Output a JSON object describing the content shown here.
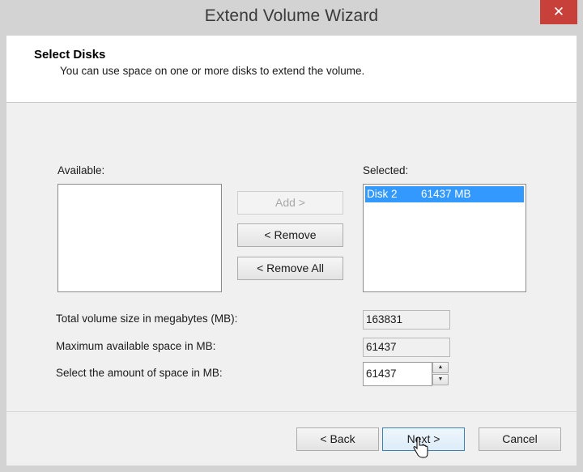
{
  "window": {
    "title": "Extend Volume Wizard",
    "close_glyph": "✕"
  },
  "header": {
    "title": "Select Disks",
    "subtitle": "You can use space on one or more disks to extend the volume."
  },
  "available": {
    "label": "Available:",
    "items": []
  },
  "selected": {
    "label": "Selected:",
    "items": [
      {
        "disk": "Disk 2",
        "size": "61437 MB",
        "selected": true
      }
    ]
  },
  "middle_buttons": {
    "add": "Add >",
    "remove": "< Remove",
    "remove_all": "< Remove All"
  },
  "fields": {
    "total_label": "Total volume size in megabytes (MB):",
    "total_value": "163831",
    "max_label": "Maximum available space in MB:",
    "max_value": "61437",
    "amount_label": "Select the amount of space in MB:",
    "amount_value": "61437"
  },
  "footer": {
    "back": "< Back",
    "next": "Next >",
    "cancel": "Cancel"
  },
  "colors": {
    "selection": "#3399ff",
    "close_button": "#c7403a"
  }
}
